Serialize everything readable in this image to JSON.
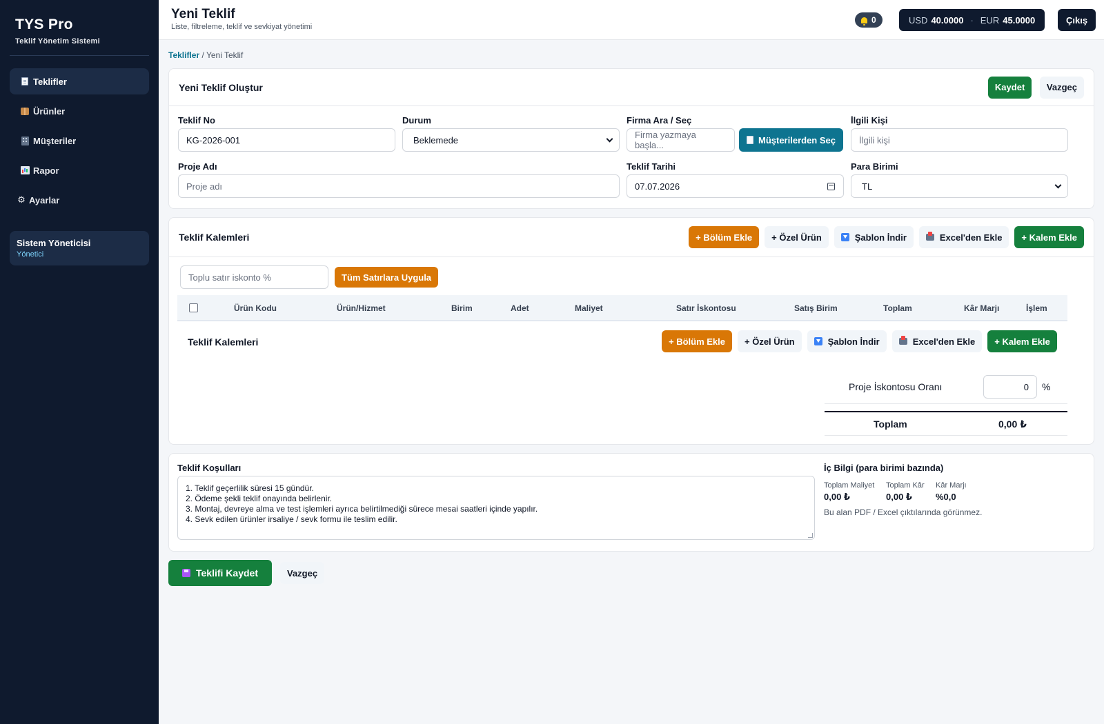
{
  "sidebar": {
    "brand": "TYS Pro",
    "brand_sub": "Teklif Yönetim Sistemi",
    "items": [
      {
        "label": "Teklifler",
        "icon": "document-icon",
        "active": true
      },
      {
        "label": "Ürünler",
        "icon": "box-icon"
      },
      {
        "label": "Müşteriler",
        "icon": "building-icon"
      },
      {
        "label": "Rapor",
        "icon": "chart-icon"
      },
      {
        "label": "Ayarlar",
        "icon": "gear-icon"
      }
    ],
    "user": {
      "name": "Sistem Yöneticisi",
      "role": "Yönetici"
    }
  },
  "header": {
    "title": "Yeni Teklif",
    "subtitle": "Liste, filtreleme, teklif ve sevkiyat yönetimi",
    "notifications": "0",
    "usd_label": "USD",
    "usd_value": "40.0000",
    "eur_label": "EUR",
    "eur_value": "45.0000",
    "logout": "Çıkış"
  },
  "breadcrumb": {
    "root": "Teklifler",
    "current": "Yeni Teklif"
  },
  "form_card": {
    "title": "Yeni Teklif Oluştur",
    "save": "Kaydet",
    "cancel": "Vazgeç",
    "fields": {
      "teklif_no_label": "Teklif No",
      "teklif_no_value": "KG-2026-001",
      "durum_label": "Durum",
      "durum_value": "Beklemede",
      "firma_label": "Firma Ara / Seç",
      "firma_placeholder": "Firma yazmaya başla...",
      "firma_button": "Müşterilerden Seç",
      "ilgili_label": "İlgili Kişi",
      "ilgili_placeholder": "İlgili kişi",
      "proje_label": "Proje Adı",
      "proje_placeholder": "Proje adı",
      "tarih_label": "Teklif Tarihi",
      "tarih_value": "07.07.2026",
      "para_label": "Para Birimi",
      "para_value": "TL"
    }
  },
  "items_card": {
    "title": "Teklif Kalemleri",
    "buttons": {
      "bolum": "+ Bölüm Ekle",
      "ozel": "+ Özel Ürün",
      "sablon": "Şablon İndir",
      "excel": "Excel'den Ekle",
      "kalem": "+ Kalem Ekle"
    },
    "bulk_placeholder": "Toplu satır iskonto %",
    "bulk_apply": "Tüm Satırlara Uygula",
    "columns": [
      "Ürün Kodu",
      "Ürün/Hizmet",
      "Birim",
      "Adet",
      "Maliyet",
      "Satır İskontosu",
      "Satış Birim",
      "Toplam",
      "Kâr Marjı",
      "İşlem"
    ],
    "inner_title": "Teklif Kalemleri",
    "discount_label": "Proje İskontosu Oranı",
    "discount_value": "0",
    "discount_unit": "%",
    "total_label": "Toplam",
    "total_value": "0,00 ₺"
  },
  "conditions": {
    "title": "Teklif Koşulları",
    "lines": [
      "1. Teklif geçerlilik süresi 15 gündür.",
      "2. Ödeme şekli teklif onayında belirlenir.",
      "3. Montaj, devreye alma ve test işlemleri ayrıca belirtilmediği sürece mesai saatleri içinde yapılır.",
      "4. Sevk edilen ürünler irsaliye / sevk formu ile teslim edilir."
    ],
    "internal_title": "İç Bilgi (para birimi bazında)",
    "stats": [
      {
        "label": "Toplam Maliyet",
        "value": "0,00 ₺"
      },
      {
        "label": "Toplam Kâr",
        "value": "0,00 ₺"
      },
      {
        "label": "Kâr Marjı",
        "value": "%0,0"
      }
    ],
    "note": "Bu alan PDF / Excel çıktılarında görünmez."
  },
  "footer": {
    "save": "Teklifi Kaydet",
    "cancel": "Vazgeç"
  }
}
